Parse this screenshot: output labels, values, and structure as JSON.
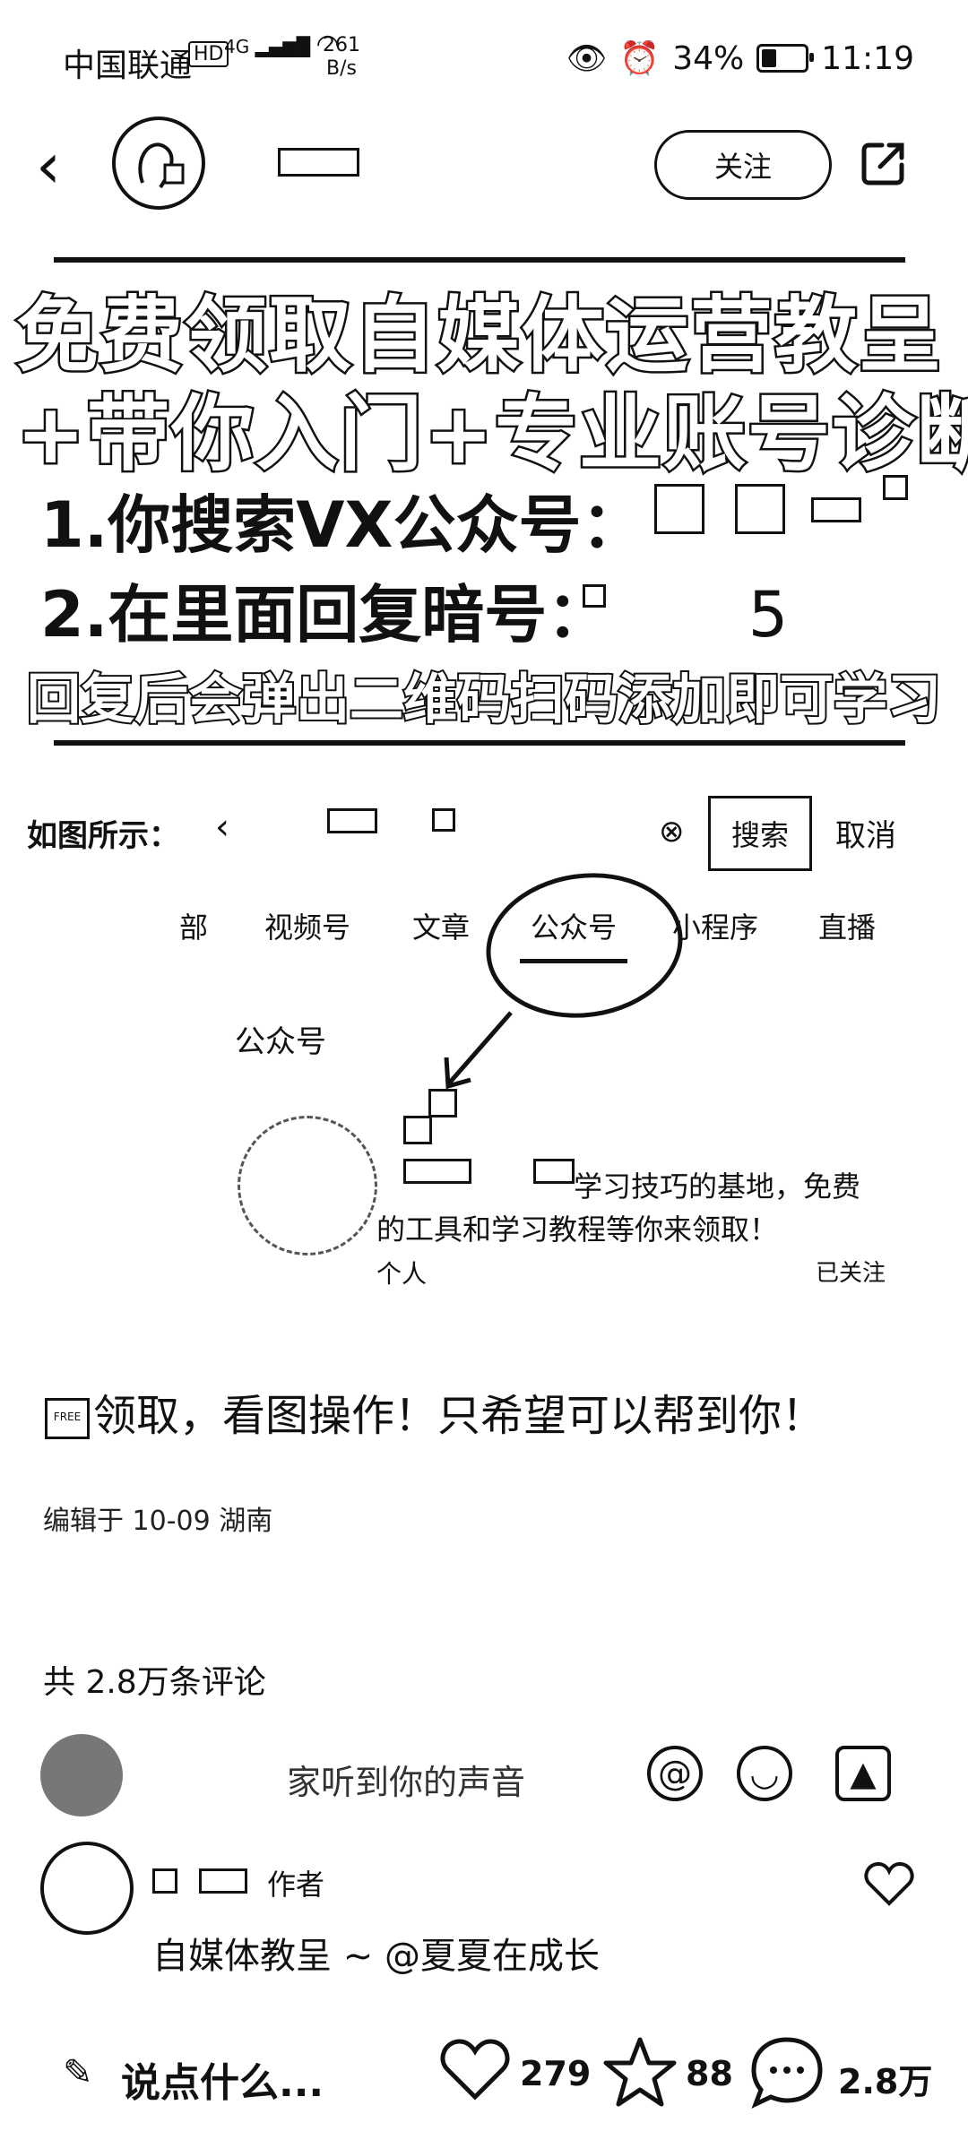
{
  "status_bar": {
    "carrier": "中国联通",
    "hd": "HD",
    "network": "4G",
    "speed": "261",
    "speed_unit": "B/s",
    "battery": "34%",
    "battery_level": 0.34,
    "time": "11:19"
  },
  "header": {
    "follow_label": "关注"
  },
  "banner": {
    "line1": "免费领取自媒体运营教呈",
    "line2": "+带你入门+专业账号诊断",
    "line3": "1.你搜索VX公众号：",
    "line4": "2.在里面回复暗号：",
    "line4_code_suffix": "5",
    "line5": "回复后会弹出二维码扫码添加即可学习"
  },
  "embedded_screenshot": {
    "label": "如图所示：",
    "search_button": "搜索",
    "cancel": "取消",
    "tabs": [
      "部",
      "视频号",
      "文章",
      "公众号",
      "小程序",
      "直播"
    ],
    "section_label": "公众号",
    "account_desc_line1": "学习技巧的基地，免费",
    "account_desc_line2": "的工具和学习教程等你来领取！",
    "account_type": "个人",
    "account_followed": "已关注"
  },
  "post": {
    "free_icon_text": "FREE",
    "text": "领取，看图操作！只希望可以帮到你！",
    "edited": "编辑于 10-09 湖南"
  },
  "comments": {
    "count_label": "共 2.8万条评论",
    "input_placeholder": "家听到你的声音",
    "first": {
      "author_tag": "作者",
      "text": "自媒体教呈 ~ @夏夏在成长"
    }
  },
  "bottom_bar": {
    "say_label": "说点什么...",
    "likes": "279",
    "stars": "88",
    "comments": "2.8万"
  }
}
